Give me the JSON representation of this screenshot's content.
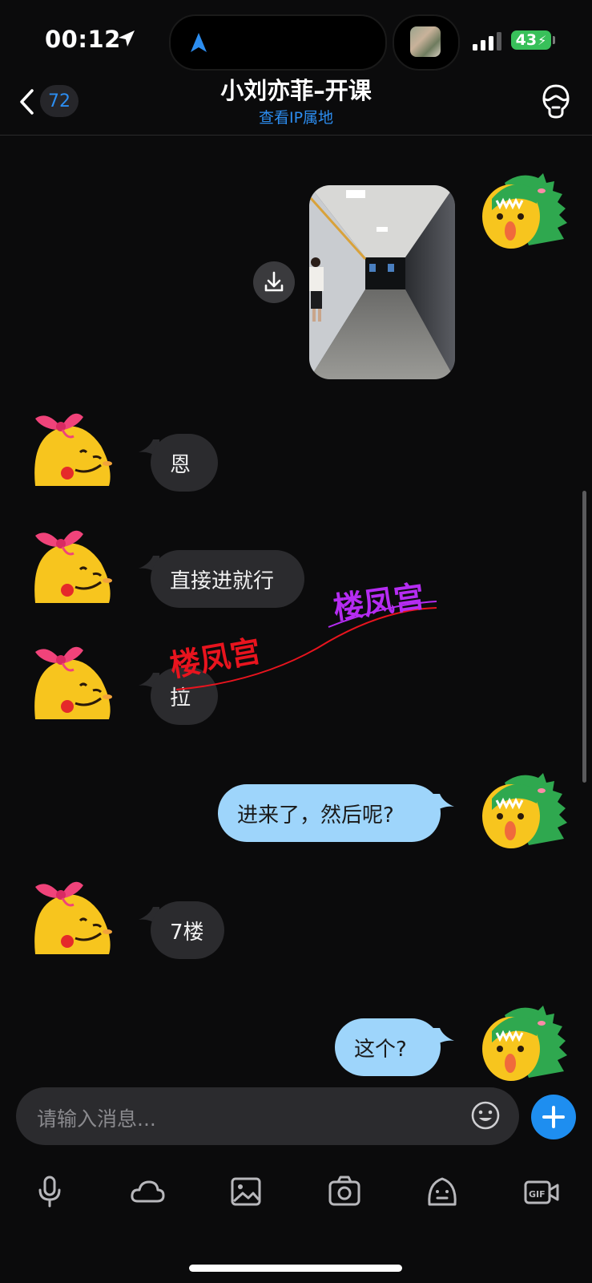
{
  "status_bar": {
    "time": "00:12",
    "battery": "43"
  },
  "header": {
    "back_badge_count": "72",
    "title": "小刘亦菲–开课",
    "subtitle": "查看IP属地"
  },
  "messages": [
    {
      "type": "image",
      "direction": "outgoing",
      "description_icon": "corridor-photo"
    },
    {
      "type": "text",
      "direction": "incoming",
      "text": "恩"
    },
    {
      "type": "text",
      "direction": "incoming",
      "text": "直接进就行"
    },
    {
      "type": "text",
      "direction": "incoming",
      "text": "拉"
    },
    {
      "type": "text",
      "direction": "outgoing",
      "text": "进来了，然后呢?"
    },
    {
      "type": "text",
      "direction": "incoming",
      "text": "7楼"
    },
    {
      "type": "text",
      "direction": "outgoing",
      "text": "这个?"
    }
  ],
  "watermark": {
    "text_red": "楼凤宫",
    "text_purple": "楼凤宫",
    "color_red": "#e8141e",
    "color_purple": "#b52cf2"
  },
  "composer": {
    "placeholder": "请输入消息..."
  },
  "toolbar": {
    "items": [
      "microphone-icon",
      "cloud-icon",
      "image-icon",
      "camera-icon",
      "sticker-icon",
      "gif-icon"
    ]
  },
  "colors": {
    "accent": "#2c8df0",
    "outgoing_bubble": "#9ed5fb",
    "incoming_bubble": "#2b2b2e",
    "background": "#0b0b0c"
  }
}
